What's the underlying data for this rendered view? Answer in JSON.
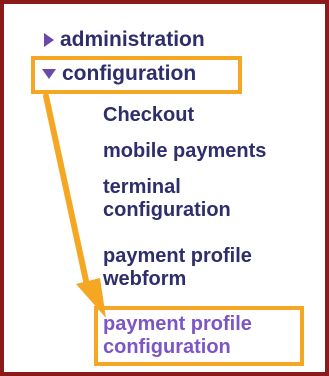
{
  "nav": {
    "administration": {
      "label": "administration",
      "icon": "triangle-right-icon"
    },
    "configuration": {
      "label": "configuration",
      "icon": "triangle-down-icon",
      "items": [
        {
          "label_lines": [
            "Checkout"
          ]
        },
        {
          "label_lines": [
            "mobile payments"
          ]
        },
        {
          "label_lines": [
            "terminal",
            "configuration"
          ]
        },
        {
          "label_lines": [
            "payment profile",
            "webform"
          ]
        },
        {
          "label_lines": [
            "payment profile",
            "configuration"
          ]
        }
      ]
    }
  },
  "colors": {
    "link": "#2e2e6b",
    "active_link": "#7b56c4",
    "highlight": "#f5a623",
    "frame_border": "#8b1a1a",
    "triangle": "#6a4aa8"
  }
}
